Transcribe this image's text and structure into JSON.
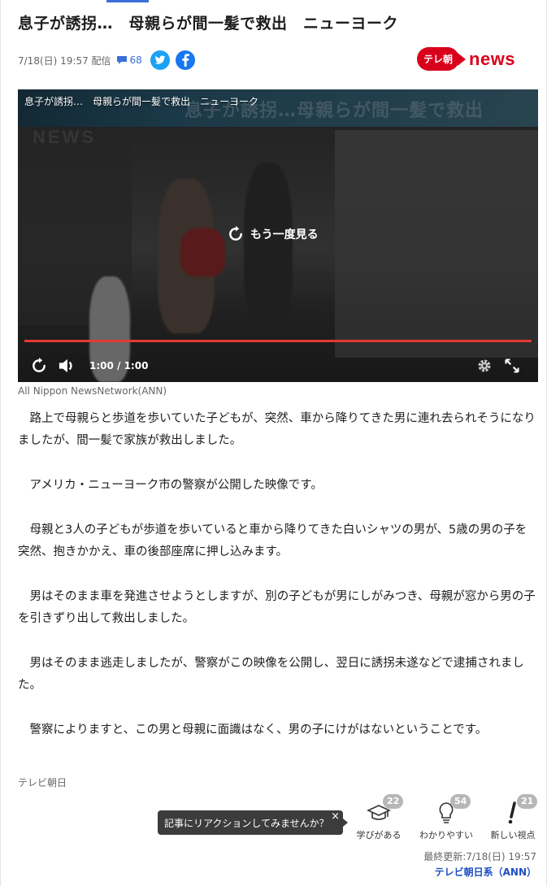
{
  "headline": "息子が誘拐…　母親らが間一髪で救出　ニューヨーク",
  "meta": {
    "date": "7/18(日) 19:57 配信",
    "comment_count": "68"
  },
  "brand": {
    "badge": "テレ朝",
    "name": "news",
    "color": "#d9001b"
  },
  "video": {
    "overlay_title": "息子が誘拐…　母親らが間一髪で救出　ニューヨーク",
    "banner_ghost_text": "息子が誘拐…母親らが間一髪で救出",
    "ghost_logo": "NEWS",
    "replay_label": "もう一度見る",
    "time": "1:00 / 1:00",
    "progress": 1.0,
    "progress_color": "#e53935"
  },
  "caption": "All Nippon NewsNetwork(ANN)",
  "article": {
    "paragraphs": [
      "路上で母親らと歩道を歩いていた子どもが、突然、車から降りてきた男に連れ去られそうになりましたが、間一髪で家族が救出しました。",
      "アメリカ・ニューヨーク市の警察が公開した映像です。",
      "母親と3人の子どもが歩道を歩いていると車から降りてきた白いシャツの男が、5歳の男の子を突然、抱きかかえ、車の後部座席に押し込みます。",
      "男はそのまま車を発進させようとしますが、別の子どもが男にしがみつき、母親が窓から男の子を引きずり出して救出しました。",
      "男はそのまま逃走しましたが、警察がこの映像を公開し、翌日に誘拐未遂などで逮捕されました。",
      "警察によりますと、この男と母親に面識はなく、男の子にけがはないということです。"
    ]
  },
  "source": "テレビ朝日",
  "reaction_prompt": {
    "text": "記事にリアクションしてみませんか？",
    "close": "×"
  },
  "reactions": [
    {
      "label": "学びがある",
      "count": "22",
      "icon": "graduation-cap-icon"
    },
    {
      "label": "わかりやすい",
      "count": "54",
      "icon": "lightbulb-icon"
    },
    {
      "label": "新しい視点",
      "count": "21",
      "icon": "exclamation-icon"
    }
  ],
  "footer": {
    "updated": "最終更新:7/18(日) 19:57",
    "provider": "テレビ朝日系（ANN）"
  },
  "colors": {
    "link": "#1d4ec2",
    "twitter": "#1da1f2",
    "facebook": "#1877f2"
  }
}
